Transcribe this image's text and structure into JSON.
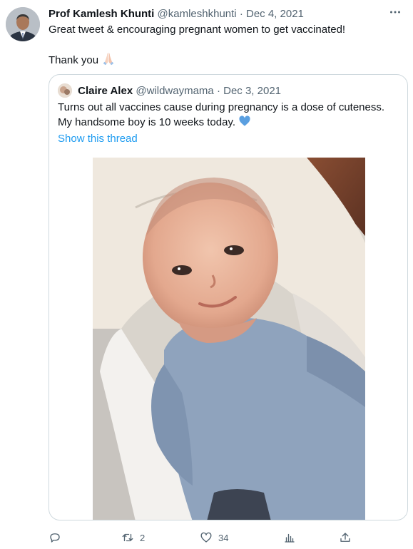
{
  "author": {
    "name": "Prof Kamlesh Khunti",
    "handle": "@kamleshkhunti",
    "separator": "·",
    "date": "Dec 4, 2021",
    "more_label": "···"
  },
  "tweet": {
    "line1": "Great tweet & encouraging pregnant women to get vaccinated!",
    "line2": "Thank you",
    "emoji_icon": "folded-hands-icon"
  },
  "quoted": {
    "name": "Claire Alex",
    "handle": "@wildwaymama",
    "separator": "·",
    "date": "Dec 3, 2021",
    "line1": "Turns out all vaccines cause during pregnancy is a dose of cuteness.",
    "line2": "My handsome boy is 10 weeks today.",
    "heart_emoji": "blue-heart-icon",
    "show_thread": "Show this thread",
    "media": "baby-photo"
  },
  "actions": {
    "reply_count": "",
    "retweet_count": "2",
    "like_count": "34",
    "views_count": "",
    "share_count": ""
  },
  "colors": {
    "link": "#1d9bf0",
    "secondary_text": "#536471",
    "border": "#cfd9de",
    "blue_heart": "#5a9fe0"
  }
}
